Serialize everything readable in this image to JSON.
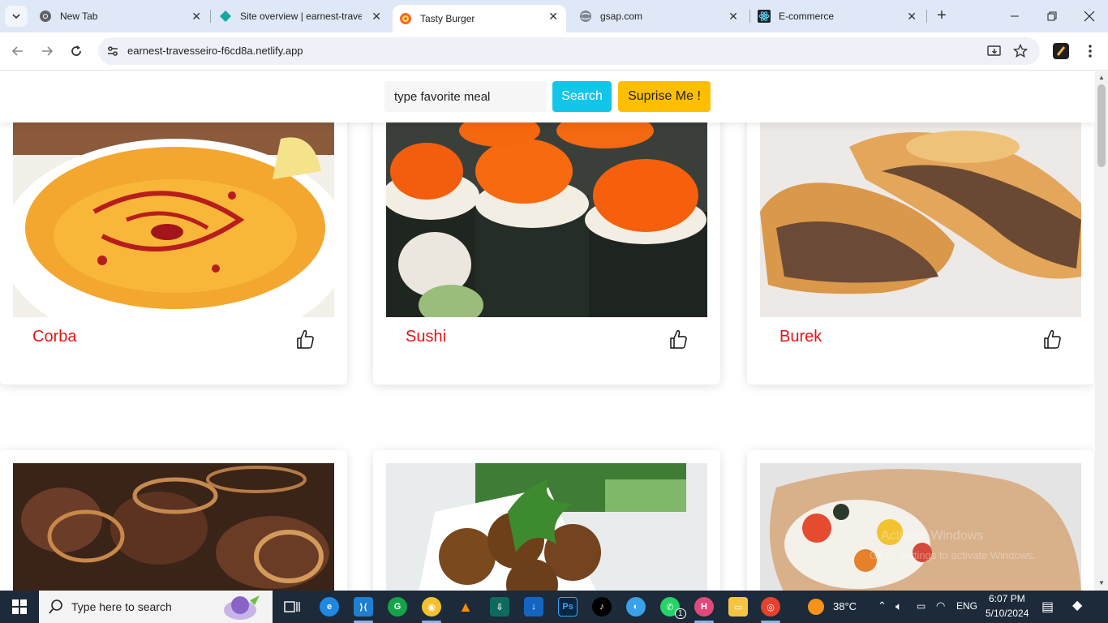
{
  "browser": {
    "tabs": [
      {
        "title": "New Tab",
        "icon": "chrome-icon"
      },
      {
        "title": "Site overview | earnest-trave",
        "icon": "netlify-icon"
      },
      {
        "title": "Tasty Burger",
        "icon": "burger-favicon-icon",
        "active": true
      },
      {
        "title": "gsap.com",
        "icon": "globe-icon"
      },
      {
        "title": "E-commerce",
        "icon": "react-icon"
      }
    ],
    "url": "earnest-travesseiro-f6cd8a.netlify.app"
  },
  "page": {
    "search_placeholder": "type favorite meal",
    "search_button": "Search",
    "surprise_button": "Suprise Me !",
    "meals": [
      {
        "name": "Corba",
        "image": "lentil-soup"
      },
      {
        "name": "Sushi",
        "image": "sushi-rolls"
      },
      {
        "name": "Burek",
        "image": "meat-pastry"
      },
      {
        "name": "",
        "image": "liver-onions"
      },
      {
        "name": "",
        "image": "falafel"
      },
      {
        "name": "",
        "image": "stuffed-pita"
      }
    ]
  },
  "taskbar": {
    "search_text": "Type here to search",
    "temperature": "38°C",
    "language": "ENG",
    "time": "6:07 PM",
    "date": "5/10/2024",
    "whatsapp_badge": "1",
    "watermark_line1": "Activate Windows",
    "watermark_line2": "Go to Settings to activate Windows."
  },
  "colors": {
    "accent_red": "#e3151a",
    "search_btn": "#12c6e9",
    "surprise_btn": "#ffbf00"
  }
}
